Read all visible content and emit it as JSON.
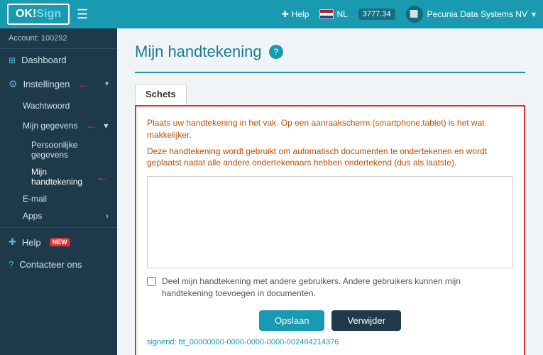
{
  "header": {
    "brand": "OK!Sign",
    "brand_ok": "OK!",
    "brand_sign": "Sign",
    "hamburger_label": "☰",
    "help_label": "Help",
    "flag_code": "NL",
    "credit_amount": "3777.34",
    "account_name": "Pecunia Data Systems NV",
    "chevron": "▾",
    "help_icon": "✚",
    "globe_icon": "🌐",
    "screen_icon": "⬜"
  },
  "sidebar": {
    "account_label": "Account: 100292",
    "dashboard_label": "Dashboard",
    "settings_label": "Instellingen",
    "wachtwoord_label": "Wachtwoord",
    "mijn_gegevens_label": "Mijn gegevens",
    "persoonlijke_label": "Persoonlijke gegevens",
    "handtekening_label": "Mijn handtekening",
    "email_label": "E-mail",
    "apps_label": "Apps",
    "help_label": "Help",
    "contact_label": "Contacteer ons",
    "new_badge": "NEW"
  },
  "content": {
    "page_title": "Mijn handtekening",
    "help_icon": "?",
    "tab_schets": "Schets",
    "info_line1": "Plaats uw handtekening in het vak. Op een aanraakscherm (smartphone,tablet) is het wat makkelijker.",
    "info_line2": "Deze handtekening wordt gebruikt om automatisch documenten te ondertekenen en wordt geplaatst nadat alle andere ondertekenaars hebben ondertekend (dus als laatste).",
    "share_text": "Deel mijn handtekening met andere gebruikers. Andere gebruikers kunnen mijn handtekening toevoegen in documenten.",
    "btn_save": "Opslaan",
    "btn_delete": "Verwijder",
    "signer_id": "signerid: bt_00000000-0000-0000-0000-002484214376"
  }
}
